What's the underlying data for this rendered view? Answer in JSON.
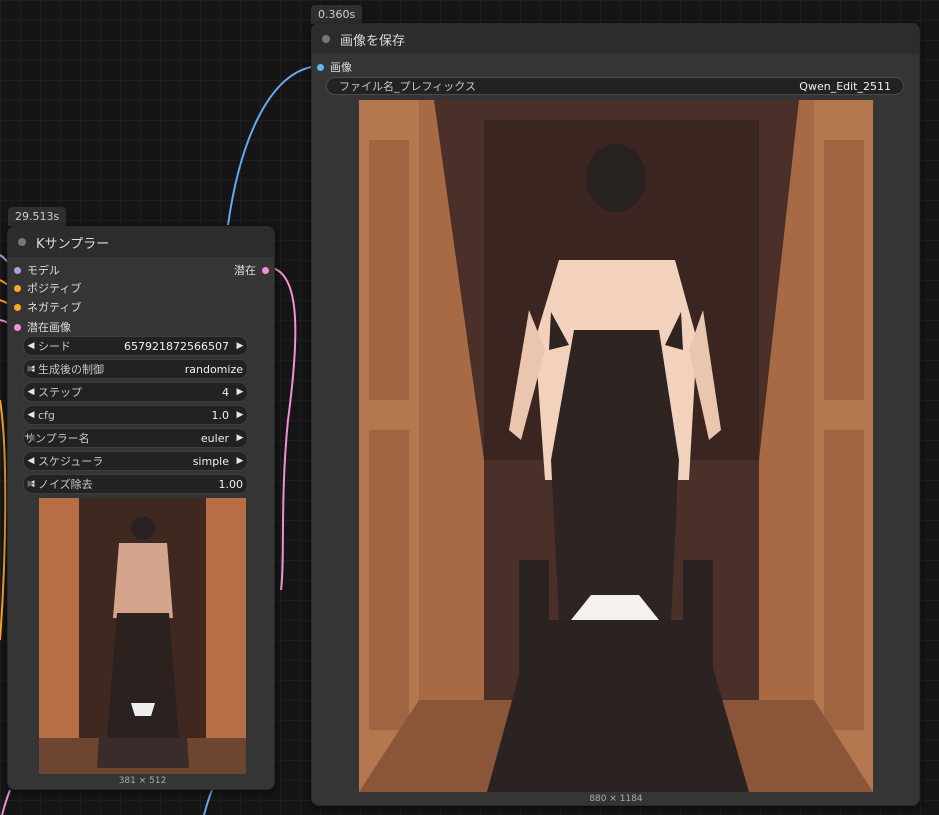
{
  "ksampler": {
    "time": "29.513s",
    "title": "Kサンプラー",
    "inputs": [
      {
        "label": "モデル",
        "color": "#b39ddb"
      },
      {
        "label": "ポジティブ",
        "color": "#ffa726"
      },
      {
        "label": "ネガティブ",
        "color": "#ffa726"
      },
      {
        "label": "潜在画像",
        "color": "#f48fd8"
      }
    ],
    "output": {
      "label": "潜在",
      "color": "#f48fd8"
    },
    "widgets": [
      {
        "label": "シード",
        "value": "657921872566507"
      },
      {
        "label": "生成後の制御",
        "value": "randomize"
      },
      {
        "label": "ステップ",
        "value": "4"
      },
      {
        "label": "cfg",
        "value": "1.0"
      },
      {
        "label": "サンプラー名",
        "value": "euler"
      },
      {
        "label": "スケジューラ",
        "value": "simple"
      },
      {
        "label": "ノイズ除去",
        "value": "1.00"
      }
    ],
    "preview_size": "381 × 512"
  },
  "save": {
    "time": "0.360s",
    "title": "画像を保存",
    "input": {
      "label": "画像",
      "color": "#64b5f6"
    },
    "prefix_label": "ファイル名_プレフィックス",
    "prefix_value": "Qwen_Edit_2511",
    "image_size": "880 × 1184"
  }
}
